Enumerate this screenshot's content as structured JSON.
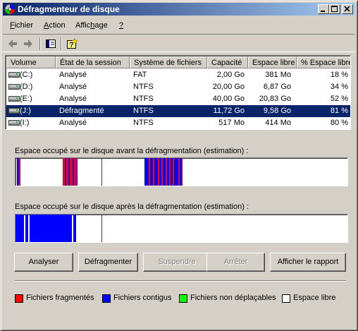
{
  "window": {
    "title": "Défragmenteur de disque",
    "controls": [
      "minimize-icon",
      "maximize-icon",
      "close-icon"
    ]
  },
  "menu": {
    "items": [
      {
        "label": "Fichier",
        "mnemonic": "F"
      },
      {
        "label": "Action",
        "mnemonic": "A"
      },
      {
        "label": "Affichage",
        "mnemonic": "h"
      },
      {
        "label": "?",
        "mnemonic": "?"
      }
    ]
  },
  "toolbar": {
    "icons": [
      "back-arrow-icon",
      "forward-arrow-icon",
      "show-hide-console-tree-icon",
      "help-icon"
    ]
  },
  "volumes": {
    "columns": [
      "Volume",
      "État de la session",
      "Système de fichiers",
      "Capacité",
      "Espace libre",
      "% Espace libre"
    ],
    "rows": [
      {
        "volume": "(C:)",
        "state": "Analysé",
        "fs": "FAT",
        "capacity": "2,00 Go",
        "free": "381 Mo",
        "pct": "18 %",
        "selected": false
      },
      {
        "volume": "(D:)",
        "state": "Analysé",
        "fs": "NTFS",
        "capacity": "20,00 Go",
        "free": "6,87 Go",
        "pct": "34 %",
        "selected": false
      },
      {
        "volume": "(E:)",
        "state": "Analysé",
        "fs": "NTFS",
        "capacity": "40,00 Go",
        "free": "20,83 Go",
        "pct": "52 %",
        "selected": false
      },
      {
        "volume": "(J:)",
        "state": "Défragmenté",
        "fs": "NTFS",
        "capacity": "11,72 Go",
        "free": "9,58 Go",
        "pct": "81 %",
        "selected": true
      },
      {
        "volume": "(I:)",
        "state": "Analysé",
        "fs": "NTFS",
        "capacity": "517 Mo",
        "free": "414 Mo",
        "pct": "80 %",
        "selected": false
      }
    ]
  },
  "maps": {
    "before_label": "Espace occupé sur le disque avant la défragmentation (estimation) :",
    "after_label": "Espace occupé sur le disque après la défragmentation (estimation) :"
  },
  "buttons": {
    "analyze": "Analyser",
    "defragment": "Défragmenter",
    "pause": "Suspendre",
    "stop": "Arrêter",
    "report": "Afficher le rapport"
  },
  "legend": [
    {
      "label": "Fichiers fragmentés",
      "color": "#ff0000"
    },
    {
      "label": "Fichiers contigus",
      "color": "#0000ff"
    },
    {
      "label": "Fichiers non déplaçables",
      "color": "#00ff00"
    },
    {
      "label": "Espace libre",
      "color": "#ffffff"
    }
  ]
}
